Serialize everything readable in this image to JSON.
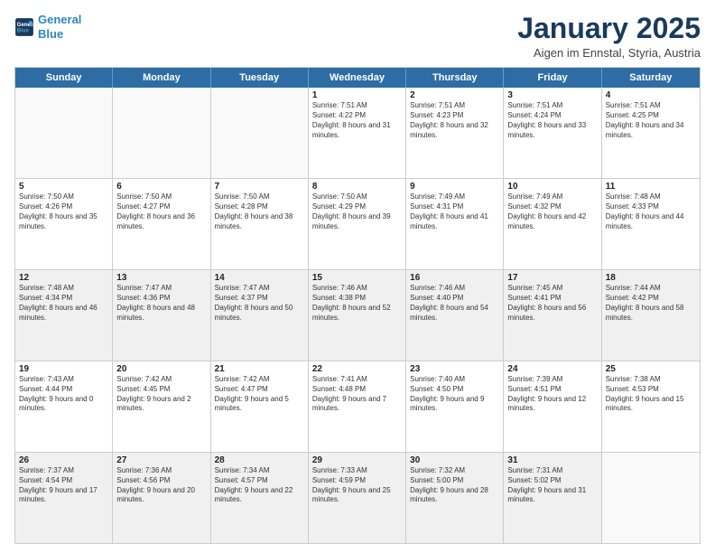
{
  "header": {
    "logo_line1": "General",
    "logo_line2": "Blue",
    "month": "January 2025",
    "location": "Aigen im Ennstal, Styria, Austria"
  },
  "weekdays": [
    "Sunday",
    "Monday",
    "Tuesday",
    "Wednesday",
    "Thursday",
    "Friday",
    "Saturday"
  ],
  "rows": [
    [
      {
        "day": "",
        "text": "",
        "empty": true
      },
      {
        "day": "",
        "text": "",
        "empty": true
      },
      {
        "day": "",
        "text": "",
        "empty": true
      },
      {
        "day": "1",
        "text": "Sunrise: 7:51 AM\nSunset: 4:22 PM\nDaylight: 8 hours and 31 minutes."
      },
      {
        "day": "2",
        "text": "Sunrise: 7:51 AM\nSunset: 4:23 PM\nDaylight: 8 hours and 32 minutes."
      },
      {
        "day": "3",
        "text": "Sunrise: 7:51 AM\nSunset: 4:24 PM\nDaylight: 8 hours and 33 minutes."
      },
      {
        "day": "4",
        "text": "Sunrise: 7:51 AM\nSunset: 4:25 PM\nDaylight: 8 hours and 34 minutes."
      }
    ],
    [
      {
        "day": "5",
        "text": "Sunrise: 7:50 AM\nSunset: 4:26 PM\nDaylight: 8 hours and 35 minutes."
      },
      {
        "day": "6",
        "text": "Sunrise: 7:50 AM\nSunset: 4:27 PM\nDaylight: 8 hours and 36 minutes."
      },
      {
        "day": "7",
        "text": "Sunrise: 7:50 AM\nSunset: 4:28 PM\nDaylight: 8 hours and 38 minutes."
      },
      {
        "day": "8",
        "text": "Sunrise: 7:50 AM\nSunset: 4:29 PM\nDaylight: 8 hours and 39 minutes."
      },
      {
        "day": "9",
        "text": "Sunrise: 7:49 AM\nSunset: 4:31 PM\nDaylight: 8 hours and 41 minutes."
      },
      {
        "day": "10",
        "text": "Sunrise: 7:49 AM\nSunset: 4:32 PM\nDaylight: 8 hours and 42 minutes."
      },
      {
        "day": "11",
        "text": "Sunrise: 7:48 AM\nSunset: 4:33 PM\nDaylight: 8 hours and 44 minutes."
      }
    ],
    [
      {
        "day": "12",
        "text": "Sunrise: 7:48 AM\nSunset: 4:34 PM\nDaylight: 8 hours and 46 minutes.",
        "shaded": true
      },
      {
        "day": "13",
        "text": "Sunrise: 7:47 AM\nSunset: 4:36 PM\nDaylight: 8 hours and 48 minutes.",
        "shaded": true
      },
      {
        "day": "14",
        "text": "Sunrise: 7:47 AM\nSunset: 4:37 PM\nDaylight: 8 hours and 50 minutes.",
        "shaded": true
      },
      {
        "day": "15",
        "text": "Sunrise: 7:46 AM\nSunset: 4:38 PM\nDaylight: 8 hours and 52 minutes.",
        "shaded": true
      },
      {
        "day": "16",
        "text": "Sunrise: 7:46 AM\nSunset: 4:40 PM\nDaylight: 8 hours and 54 minutes.",
        "shaded": true
      },
      {
        "day": "17",
        "text": "Sunrise: 7:45 AM\nSunset: 4:41 PM\nDaylight: 8 hours and 56 minutes.",
        "shaded": true
      },
      {
        "day": "18",
        "text": "Sunrise: 7:44 AM\nSunset: 4:42 PM\nDaylight: 8 hours and 58 minutes.",
        "shaded": true
      }
    ],
    [
      {
        "day": "19",
        "text": "Sunrise: 7:43 AM\nSunset: 4:44 PM\nDaylight: 9 hours and 0 minutes."
      },
      {
        "day": "20",
        "text": "Sunrise: 7:42 AM\nSunset: 4:45 PM\nDaylight: 9 hours and 2 minutes."
      },
      {
        "day": "21",
        "text": "Sunrise: 7:42 AM\nSunset: 4:47 PM\nDaylight: 9 hours and 5 minutes."
      },
      {
        "day": "22",
        "text": "Sunrise: 7:41 AM\nSunset: 4:48 PM\nDaylight: 9 hours and 7 minutes."
      },
      {
        "day": "23",
        "text": "Sunrise: 7:40 AM\nSunset: 4:50 PM\nDaylight: 9 hours and 9 minutes."
      },
      {
        "day": "24",
        "text": "Sunrise: 7:39 AM\nSunset: 4:51 PM\nDaylight: 9 hours and 12 minutes."
      },
      {
        "day": "25",
        "text": "Sunrise: 7:38 AM\nSunset: 4:53 PM\nDaylight: 9 hours and 15 minutes."
      }
    ],
    [
      {
        "day": "26",
        "text": "Sunrise: 7:37 AM\nSunset: 4:54 PM\nDaylight: 9 hours and 17 minutes.",
        "shaded": true
      },
      {
        "day": "27",
        "text": "Sunrise: 7:36 AM\nSunset: 4:56 PM\nDaylight: 9 hours and 20 minutes.",
        "shaded": true
      },
      {
        "day": "28",
        "text": "Sunrise: 7:34 AM\nSunset: 4:57 PM\nDaylight: 9 hours and 22 minutes.",
        "shaded": true
      },
      {
        "day": "29",
        "text": "Sunrise: 7:33 AM\nSunset: 4:59 PM\nDaylight: 9 hours and 25 minutes.",
        "shaded": true
      },
      {
        "day": "30",
        "text": "Sunrise: 7:32 AM\nSunset: 5:00 PM\nDaylight: 9 hours and 28 minutes.",
        "shaded": true
      },
      {
        "day": "31",
        "text": "Sunrise: 7:31 AM\nSunset: 5:02 PM\nDaylight: 9 hours and 31 minutes.",
        "shaded": true
      },
      {
        "day": "",
        "text": "",
        "empty": true,
        "shaded": false
      }
    ]
  ]
}
